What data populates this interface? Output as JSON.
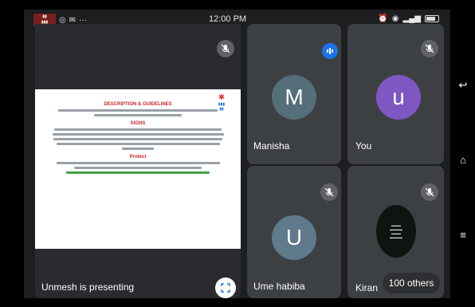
{
  "status_bar": {
    "time": "12:00 PM",
    "left_icons": [
      "app-thumbnail",
      "whatsapp-icon",
      "mail-icon",
      "more-icon"
    ],
    "right_icons": [
      "alarm-icon",
      "sound-icon",
      "signal-icon",
      "battery-icon"
    ]
  },
  "presenter": {
    "label": "Unmesh is presenting",
    "doc": {
      "title": "DESCRIPTION & GUIDELINES",
      "section1": "SIGNS",
      "section2": "Protect"
    }
  },
  "participants": [
    {
      "name": "Manisha",
      "initial": "M",
      "avatar_color": "#546e7a",
      "muted": false,
      "speaking": true
    },
    {
      "name": "You",
      "initial": "u",
      "avatar_color": "#7e57c2",
      "muted": true
    },
    {
      "name": "Ume habiba",
      "initial": "U",
      "avatar_color": "#5f7a8a",
      "muted": true
    },
    {
      "name": "Kiran",
      "muted": true,
      "others_label": "100 others"
    }
  ],
  "nav": [
    "back-icon",
    "home-icon",
    "menu-icon"
  ]
}
